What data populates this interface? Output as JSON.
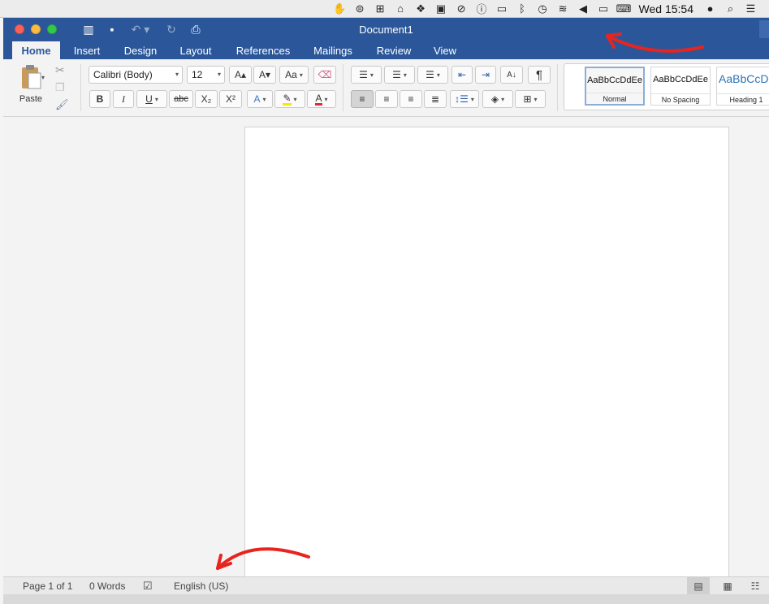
{
  "menubar": {
    "clock": "Wed 15:54",
    "icons": [
      "hand-icon",
      "quote-icon",
      "app-icon",
      "bank-icon",
      "dropbox-icon",
      "photo-icon",
      "no-entry-icon",
      "info-icon",
      "airplay-icon",
      "bluetooth-icon",
      "time-machine-icon",
      "wifi-icon",
      "volume-icon",
      "battery-icon",
      "keyboard-icon",
      "user-icon",
      "spotlight-icon",
      "list-icon"
    ]
  },
  "window": {
    "title": "Document1"
  },
  "tabs": [
    "Home",
    "Insert",
    "Design",
    "Layout",
    "References",
    "Mailings",
    "Review",
    "View"
  ],
  "ribbon": {
    "paste_label": "Paste",
    "font_name": "Calibri (Body)",
    "font_size": "12",
    "bold": "B",
    "italic": "I",
    "underline": "U",
    "strikethrough": "abc",
    "subscript": "X₂",
    "superscript": "X²",
    "grow_font": "A▴",
    "shrink_font": "A▾",
    "change_case": "Aa",
    "pilcrow": "¶",
    "styles": [
      {
        "preview": "AaBbCcDdEe",
        "name": "Normal"
      },
      {
        "preview": "AaBbCcDdEe",
        "name": "No Spacing"
      },
      {
        "preview": "AaBbCcDd",
        "name": "Heading 1"
      }
    ]
  },
  "status": {
    "page": "Page 1 of 1",
    "words": "0 Words",
    "language": "English (US)"
  },
  "colors": {
    "word_blue": "#2b579a",
    "highlight": "#ffe600",
    "font_color": "#e32b2b",
    "annotation_arrow": "#e8241f"
  }
}
